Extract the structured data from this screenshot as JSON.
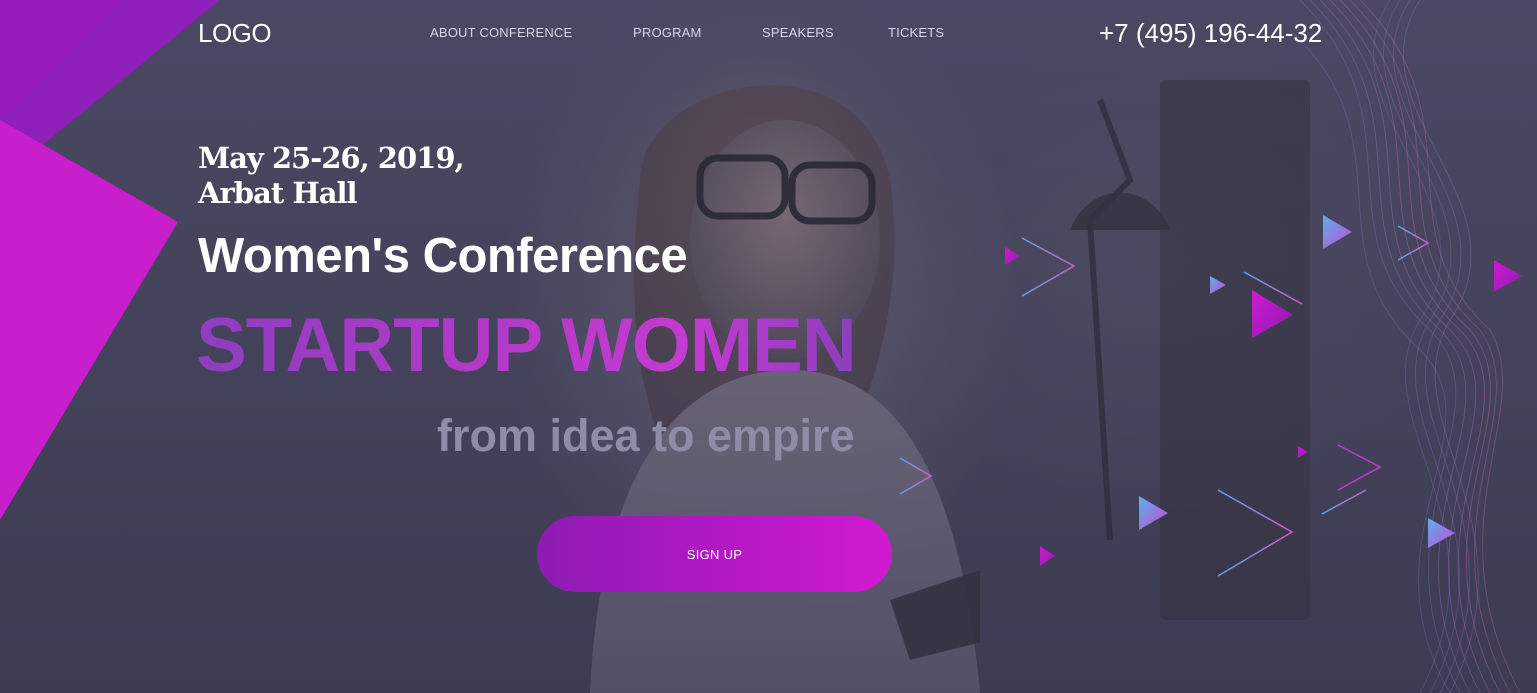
{
  "header": {
    "logo": "LOGO",
    "nav": [
      {
        "label": "ABOUT CONFERENCE"
      },
      {
        "label": "PROGRAM"
      },
      {
        "label": "SPEAKERS"
      },
      {
        "label": "TICKETS"
      }
    ],
    "phone": "+7 (495) 196-44-32"
  },
  "hero": {
    "date_line_1": "May 25-26, 2019,",
    "date_line_2": "Arbat Hall",
    "subtitle": "Women's Conference",
    "title": "STARTUP WOMEN",
    "tagline": "from idea to empire",
    "cta_label": "SIGN UP"
  },
  "colors": {
    "background": "#43425a",
    "accent_magenta": "#d11ad0",
    "accent_purple": "#8d1bb2",
    "tagline_gray": "#8f8ca8",
    "triangle_blue": "#5a9ee6"
  },
  "icons": [
    "play-triangle-icon",
    "chevron-outline-icon"
  ]
}
